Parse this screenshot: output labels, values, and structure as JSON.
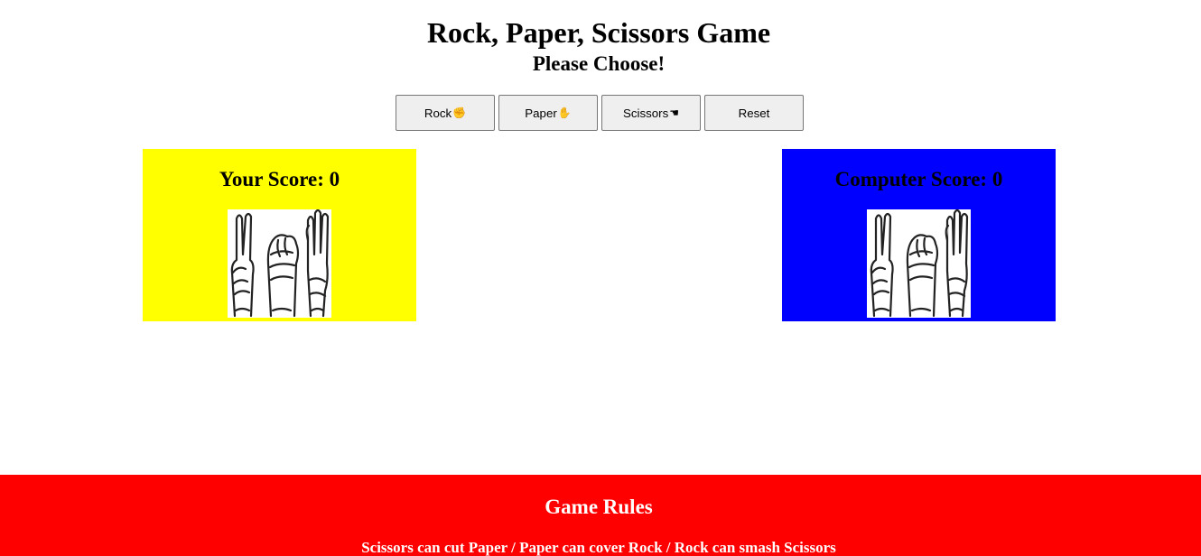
{
  "header": {
    "title": "Rock, Paper, Scissors Game",
    "subtitle": "Please Choose!"
  },
  "buttons": {
    "rock": {
      "label": "Rock",
      "emoji": "✊"
    },
    "paper": {
      "label": "Paper",
      "emoji": "✋"
    },
    "scissors": {
      "label": "Scissors",
      "emoji": "☚"
    },
    "reset": {
      "label": "Reset"
    }
  },
  "player": {
    "score_text": "Your Score: 0",
    "color": "#ffff00",
    "image_icon": "rock-paper-scissors-hands-image"
  },
  "computer": {
    "score_text": "Computer Score: 0",
    "color": "#0000ff",
    "image_icon": "rock-paper-scissors-hands-image"
  },
  "rules": {
    "title": "Game Rules",
    "text": "Scissors can cut Paper / Paper can cover Rock / Rock can smash Scissors",
    "color": "#ff0000"
  }
}
